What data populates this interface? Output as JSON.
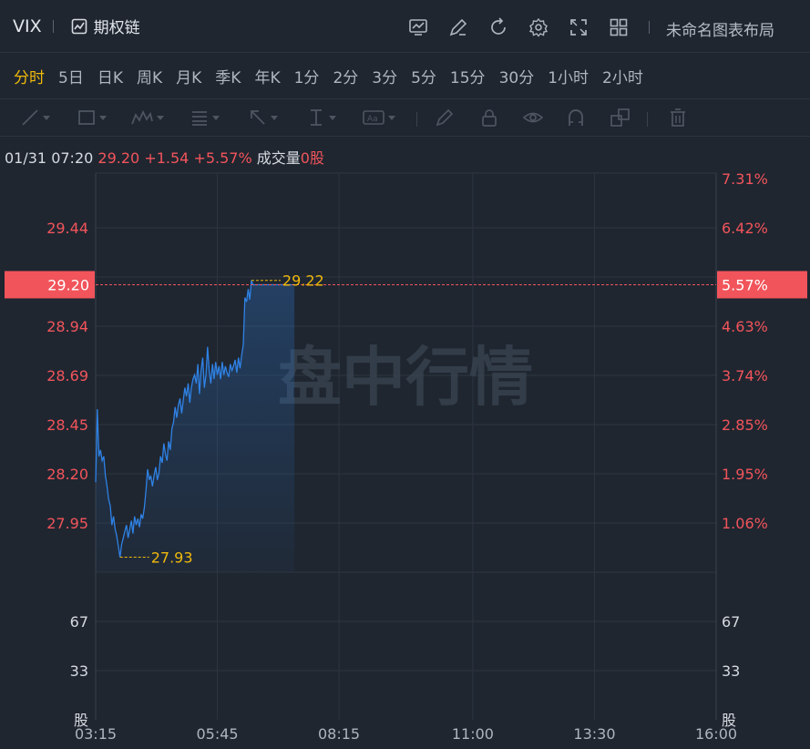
{
  "header": {
    "symbol": "VIX",
    "option_chain_label": "期权链",
    "layout_name": "未命名图表布局",
    "icons": [
      "chart-indicator-icon",
      "edit-icon",
      "refresh-icon",
      "settings-icon",
      "fullscreen-icon",
      "grid-layout-icon"
    ]
  },
  "periods": [
    "分时",
    "5日",
    "日K",
    "周K",
    "月K",
    "季K",
    "年K",
    "1分",
    "2分",
    "3分",
    "5分",
    "15分",
    "30分",
    "1小时",
    "2小时"
  ],
  "active_period": "分时",
  "draw_tools": [
    "trend-line-icon",
    "rectangle-icon",
    "pattern-icon",
    "fib-icon",
    "arrow-icon",
    "measure-icon",
    "text-icon",
    "pencil-icon",
    "lock-icon",
    "eye-icon",
    "magnet-icon",
    "clone-icon",
    "trash-icon"
  ],
  "info": {
    "datetime": "01/31 07:20",
    "price": "29.20",
    "change": "+1.54",
    "change_pct": "+5.57%",
    "volume_label": "成交量",
    "volume_value": "0股"
  },
  "watermark": "盘中行情",
  "colors": {
    "background": "#1f2630",
    "accent": "#f0b90b",
    "up": "#f2545b",
    "line": "#2f82e6"
  },
  "chart_data": {
    "type": "line",
    "title": "",
    "xlabel": "",
    "ylabel": "",
    "x_ticks": [
      "03:15",
      "05:45",
      "08:15",
      "11:00",
      "13:30",
      "16:00"
    ],
    "y_ticks_left": [
      "29.44",
      "28.94",
      "28.69",
      "28.45",
      "28.20",
      "27.95"
    ],
    "y_ticks_right": [
      "7.31%",
      "6.42%",
      "4.63%",
      "3.74%",
      "2.85%",
      "1.95%",
      "1.06%"
    ],
    "current_price": "29.20",
    "current_pct": "5.57%",
    "high_label": "29.22",
    "low_label": "27.93",
    "volume_ticks": [
      "67",
      "33",
      "股"
    ],
    "x_start_min": 195,
    "x_end_min": 960,
    "y_range": [
      27.86,
      29.72
    ],
    "series": [
      {
        "x": [
          195,
          197,
          199,
          201,
          203,
          205,
          207,
          209,
          211,
          213,
          215,
          217,
          219,
          221,
          223,
          225,
          227,
          229,
          231,
          233,
          235,
          237,
          239,
          241,
          243,
          245,
          247,
          249,
          251,
          253,
          255,
          257,
          259,
          261,
          263,
          265,
          267,
          269,
          271,
          273,
          275,
          277,
          279,
          281,
          283,
          285,
          287,
          289,
          291,
          293,
          295,
          297,
          299,
          301,
          303,
          305,
          307,
          309,
          311,
          313,
          315,
          317,
          319,
          321,
          323,
          325,
          327,
          329,
          331,
          333,
          335,
          337,
          339,
          341,
          343,
          345,
          347,
          349,
          351,
          353,
          355,
          357,
          359,
          361,
          363,
          365,
          367,
          369,
          371,
          373,
          375,
          377,
          379,
          381,
          383,
          385,
          387,
          389,
          391,
          393,
          395,
          397,
          399,
          401,
          403,
          405,
          407,
          409,
          411,
          413,
          415,
          417,
          419,
          421,
          423,
          425,
          427,
          429,
          431,
          433,
          435,
          437,
          440
        ],
        "y": [
          28.28,
          28.62,
          28.4,
          28.43,
          28.38,
          28.4,
          28.31,
          28.26,
          28.2,
          28.17,
          28.08,
          28.12,
          28.06,
          28.03,
          27.98,
          27.93,
          27.99,
          28.02,
          28.05,
          28.08,
          28.02,
          28.06,
          28.1,
          28.04,
          28.12,
          28.08,
          28.11,
          28.07,
          28.13,
          28.11,
          28.16,
          28.24,
          28.34,
          28.29,
          28.31,
          28.26,
          28.31,
          28.35,
          28.29,
          28.32,
          28.4,
          28.37,
          28.46,
          28.41,
          28.38,
          28.47,
          28.43,
          28.53,
          28.56,
          28.63,
          28.58,
          28.64,
          28.67,
          28.6,
          28.66,
          28.72,
          28.68,
          28.74,
          28.65,
          28.72,
          28.76,
          28.78,
          28.74,
          28.83,
          28.69,
          28.8,
          28.86,
          28.72,
          28.78,
          28.91,
          28.8,
          28.74,
          28.83,
          28.76,
          28.84,
          28.78,
          28.82,
          28.76,
          28.84,
          28.78,
          28.82,
          28.79,
          28.77,
          28.83,
          28.8,
          28.82,
          28.85,
          28.79,
          28.86,
          28.81,
          28.87,
          28.92,
          29.14,
          29.12,
          29.18,
          29.13,
          29.22,
          29.2,
          29.2,
          29.2,
          29.2,
          29.2,
          29.2,
          29.2,
          29.2,
          29.2,
          29.2,
          29.2,
          29.2,
          29.2,
          29.2,
          29.2,
          29.2,
          29.2,
          29.2,
          29.2,
          29.2,
          29.2,
          29.2,
          29.2,
          29.2,
          29.2,
          29.2
        ]
      }
    ]
  }
}
